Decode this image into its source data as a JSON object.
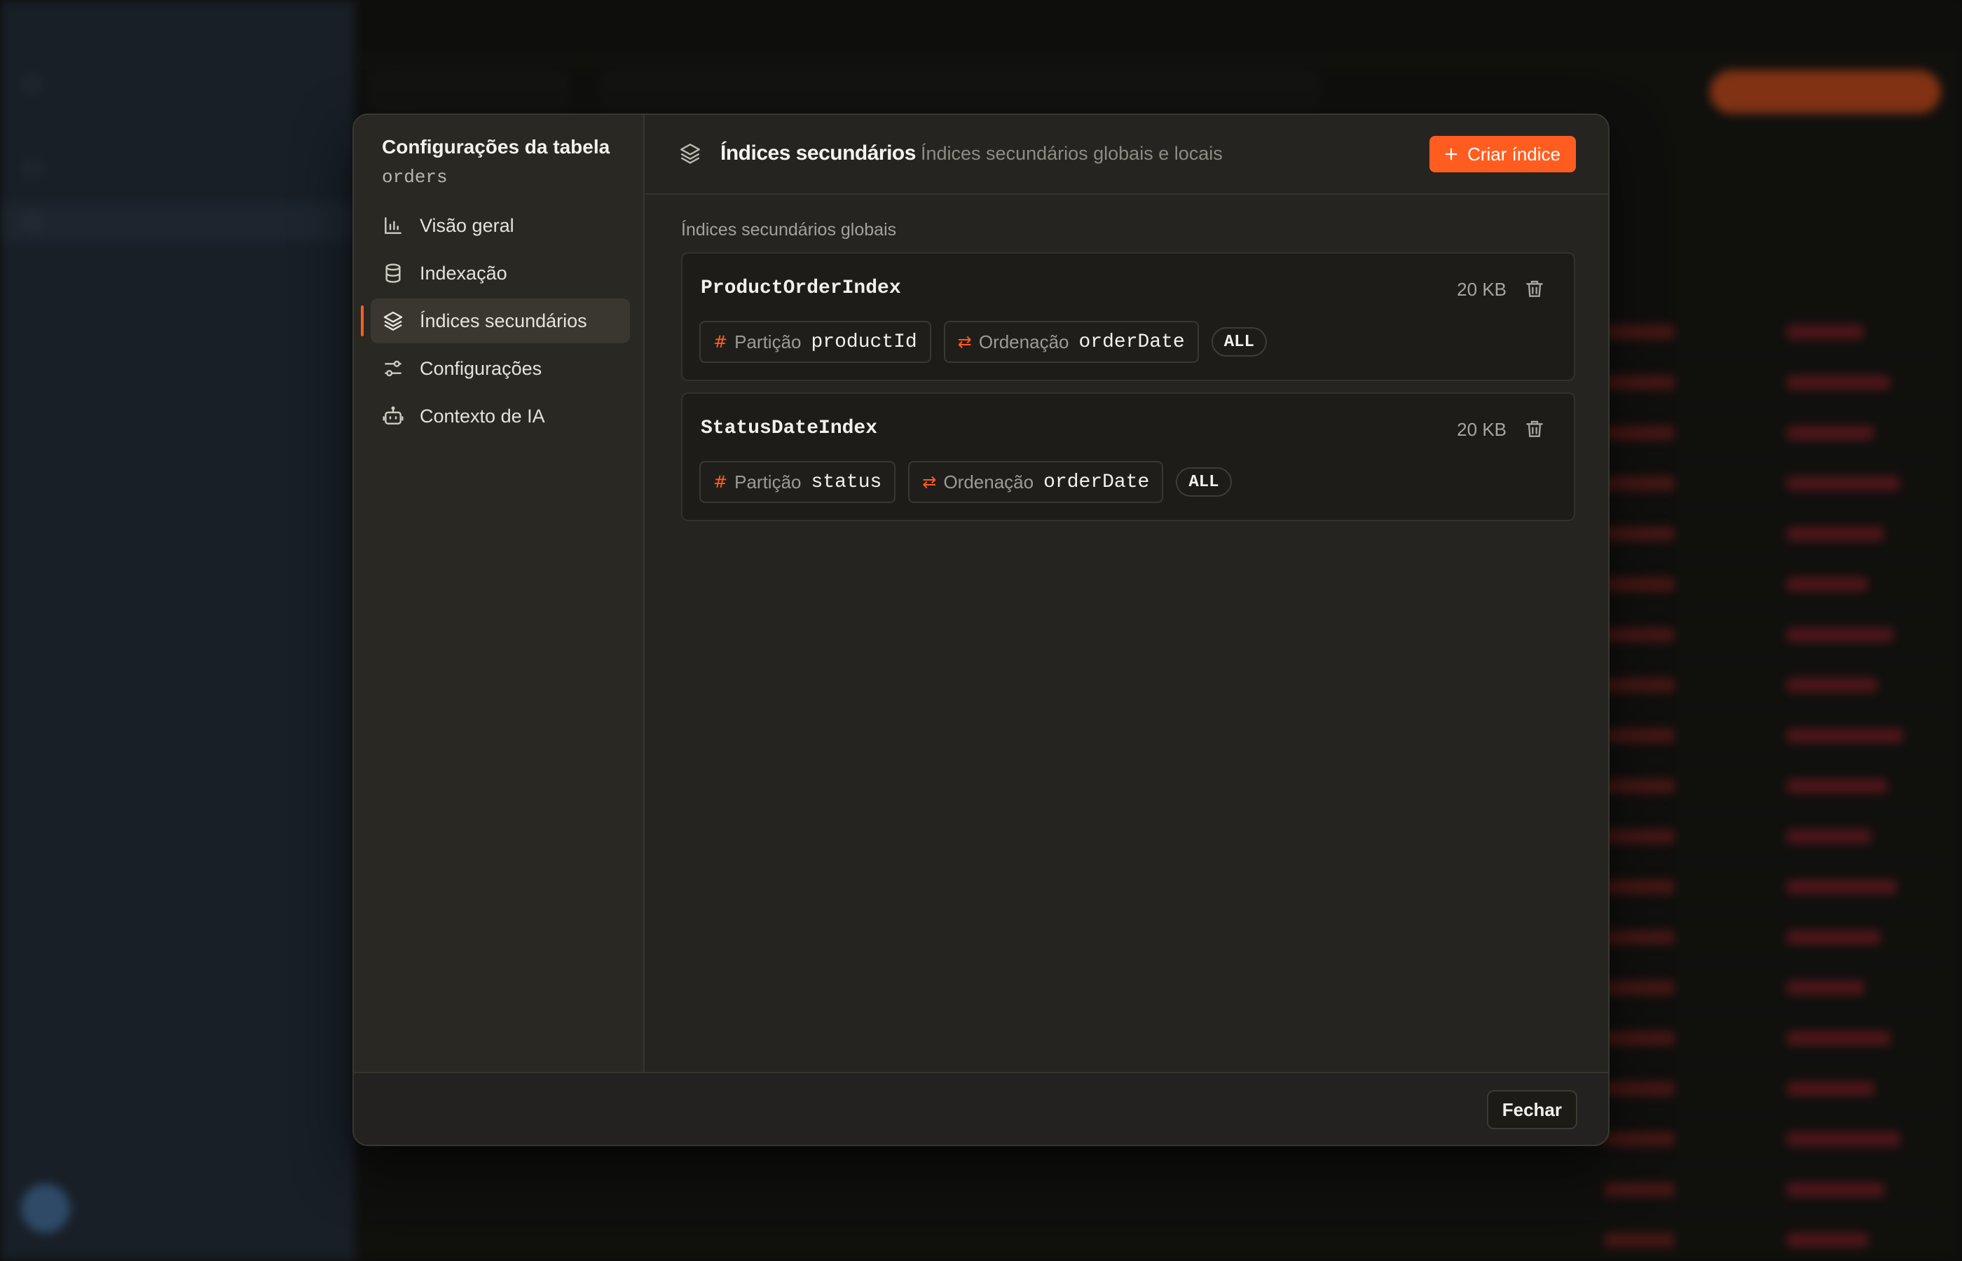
{
  "modal": {
    "title": "Configurações da tabela",
    "table_name": "orders",
    "nav": [
      {
        "id": "overview",
        "label": "Visão geral",
        "icon": "bar-chart-icon"
      },
      {
        "id": "indexing",
        "label": "Indexação",
        "icon": "database-icon"
      },
      {
        "id": "secondary",
        "label": "Índices secundários",
        "icon": "layers-icon",
        "active": true
      },
      {
        "id": "settings",
        "label": "Configurações",
        "icon": "sliders-icon"
      },
      {
        "id": "ai",
        "label": "Contexto de IA",
        "icon": "bot-icon"
      }
    ],
    "header": {
      "title": "Índices secundários",
      "description": "Índices secundários globais e locais",
      "create_label": "Criar índice"
    },
    "section_label": "Índices secundários globais",
    "indexes": [
      {
        "name": "ProductOrderIndex",
        "size": "20 KB",
        "partition_label": "Partição",
        "partition_key": "productId",
        "sort_label": "Ordenação",
        "sort_key": "orderDate",
        "projection": "ALL"
      },
      {
        "name": "StatusDateIndex",
        "size": "20 KB",
        "partition_label": "Partição",
        "partition_key": "status",
        "sort_label": "Ordenação",
        "sort_key": "orderDate",
        "projection": "ALL"
      }
    ],
    "close_label": "Fechar"
  },
  "colors": {
    "accent": "#ff5d1f",
    "modal_bg": "#262420",
    "card_bg": "#1e1c19",
    "sidebar_bg": "#233040"
  }
}
